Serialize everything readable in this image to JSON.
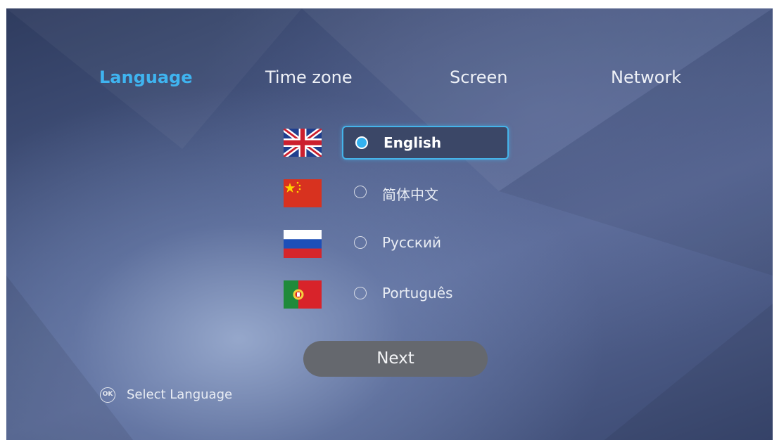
{
  "tabs": [
    {
      "label": "Language",
      "active": true
    },
    {
      "label": "Time zone",
      "active": false
    },
    {
      "label": "Screen",
      "active": false
    },
    {
      "label": "Network",
      "active": false
    }
  ],
  "languages": [
    {
      "label": "English",
      "flag": "uk-flag-icon",
      "selected": true
    },
    {
      "label": "简体中文",
      "flag": "china-flag-icon",
      "selected": false
    },
    {
      "label": "Русский",
      "flag": "russia-flag-icon",
      "selected": false
    },
    {
      "label": "Português",
      "flag": "portugal-flag-icon",
      "selected": false
    }
  ],
  "next_button": {
    "label": "Next"
  },
  "hint": {
    "icon_text": "OK",
    "label": "Select Language"
  },
  "colors": {
    "accent": "#3fb4f0",
    "button": "#65686e",
    "selected_option_bg": "#3b4767"
  }
}
